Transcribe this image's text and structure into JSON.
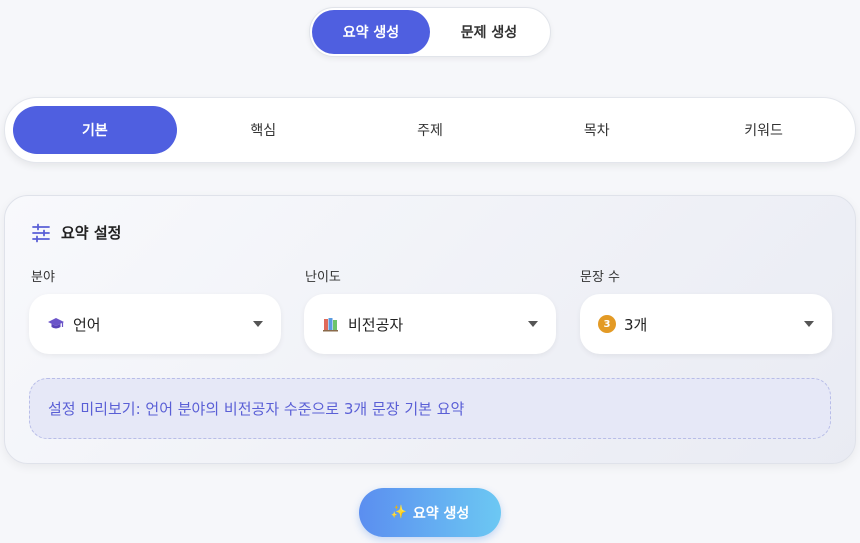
{
  "mode_toggle": {
    "items": [
      {
        "label": "요약 생성",
        "active": true
      },
      {
        "label": "문제 생성",
        "active": false
      }
    ]
  },
  "tabs": [
    {
      "label": "기본",
      "active": true
    },
    {
      "label": "핵심",
      "active": false
    },
    {
      "label": "주제",
      "active": false
    },
    {
      "label": "목차",
      "active": false
    },
    {
      "label": "키워드",
      "active": false
    }
  ],
  "settings": {
    "title": "요약 설정",
    "title_icon": "sliders-icon",
    "fields": [
      {
        "label": "분야",
        "value": "언어",
        "icon": "graduation-cap-icon"
      },
      {
        "label": "난이도",
        "value": "비전공자",
        "icon": "books-icon"
      },
      {
        "label": "문장 수",
        "value": "3개",
        "icon": "number-badge-icon",
        "badge": "3"
      }
    ],
    "preview": "설정 미리보기: 언어 분야의 비전공자 수준으로 3개 문장 기본 요약"
  },
  "generate_button": {
    "label": "요약 생성",
    "icon": "sparkles-icon"
  },
  "colors": {
    "accent": "#4f5fe0",
    "preview_text": "#5a5fd6",
    "badge": "#e39a25"
  }
}
